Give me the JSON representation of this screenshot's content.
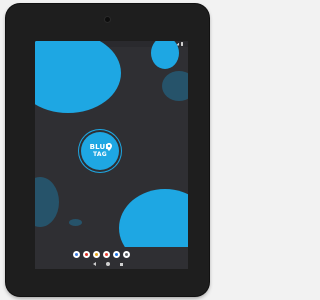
{
  "status_bar": {
    "clock": "",
    "icons": [
      "wifi-icon",
      "signal-icon",
      "battery-icon"
    ]
  },
  "splash": {
    "logo_line1": "BLUE",
    "logo_line2": "TAG",
    "logo_icon": "map-pin-icon",
    "brand_color": "#1ea7e3",
    "background_color": "#2f2f33"
  },
  "dock": {
    "apps": [
      {
        "icon": "phone-app-icon",
        "color": "#3b7be0"
      },
      {
        "icon": "gmail-app-icon",
        "color": "#d93025"
      },
      {
        "icon": "chrome-app-icon",
        "color": "#e8a317"
      },
      {
        "icon": "photos-app-icon",
        "color": "#ea4335"
      },
      {
        "icon": "camera-app-icon",
        "color": "#1a73e8"
      },
      {
        "icon": "settings-app-icon",
        "color": "#5f6368"
      }
    ]
  },
  "navigation": {
    "buttons": [
      "back-icon",
      "home-icon",
      "recents-icon"
    ]
  }
}
